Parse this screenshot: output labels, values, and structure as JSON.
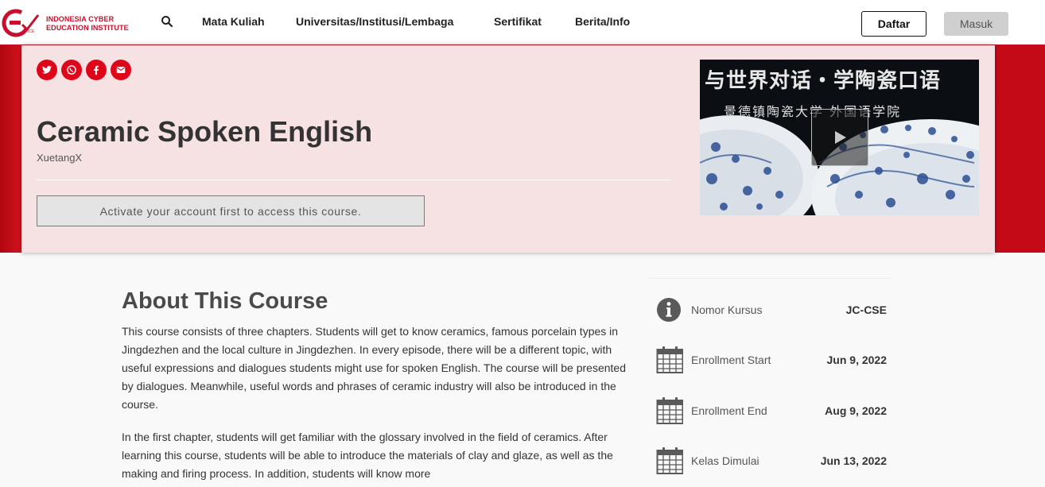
{
  "nav": {
    "logo_line1": "INDONESIA CYBER",
    "logo_line2": "EDUCATION INSTITUTE",
    "links": [
      "Mata Kuliah",
      "Universitas/Institusi/Lembaga",
      "Sertifikat",
      "Berita/Info"
    ],
    "daftar": "Daftar",
    "masuk": "Masuk"
  },
  "hero": {
    "title": "Ceramic Spoken English",
    "org": "XuetangX",
    "activate": "Activate your account first to access this course.",
    "video_line1": "与世界对话・学陶瓷口语",
    "video_line2": "景德镇陶瓷大学 外国语学院"
  },
  "about": {
    "title": "About This Course",
    "p1": "This course consists of three chapters. Students will get to know ceramics, famous porcelain types in Jingdezhen and the local culture in Jingdezhen. In every episode, there will be a different topic, with useful expressions and dialogues students might use for spoken English. The course will be presented by dialogues. Meanwhile, useful words and phrases of ceramic industry will also be introduced in the course.",
    "p2": "In the first chapter, students will get familiar with the glossary involved in the field of ceramics. After learning this course, students will be able to introduce the materials of clay and glaze, as well as the making and firing process. In addition, students will know more"
  },
  "info": [
    {
      "icon": "info-circle-icon",
      "label": "Nomor Kursus",
      "value": "JC-CSE"
    },
    {
      "icon": "calendar-icon",
      "label": "Enrollment Start",
      "value": "Jun 9, 2022"
    },
    {
      "icon": "calendar-icon",
      "label": "Enrollment End",
      "value": "Aug 9, 2022"
    },
    {
      "icon": "calendar-icon",
      "label": "Kelas Dimulai",
      "value": "Jun 13, 2022"
    }
  ],
  "colors": {
    "brand_red": "#c8102e",
    "share_red": "#e0061a",
    "hero_bg": "#f6e2e3"
  }
}
